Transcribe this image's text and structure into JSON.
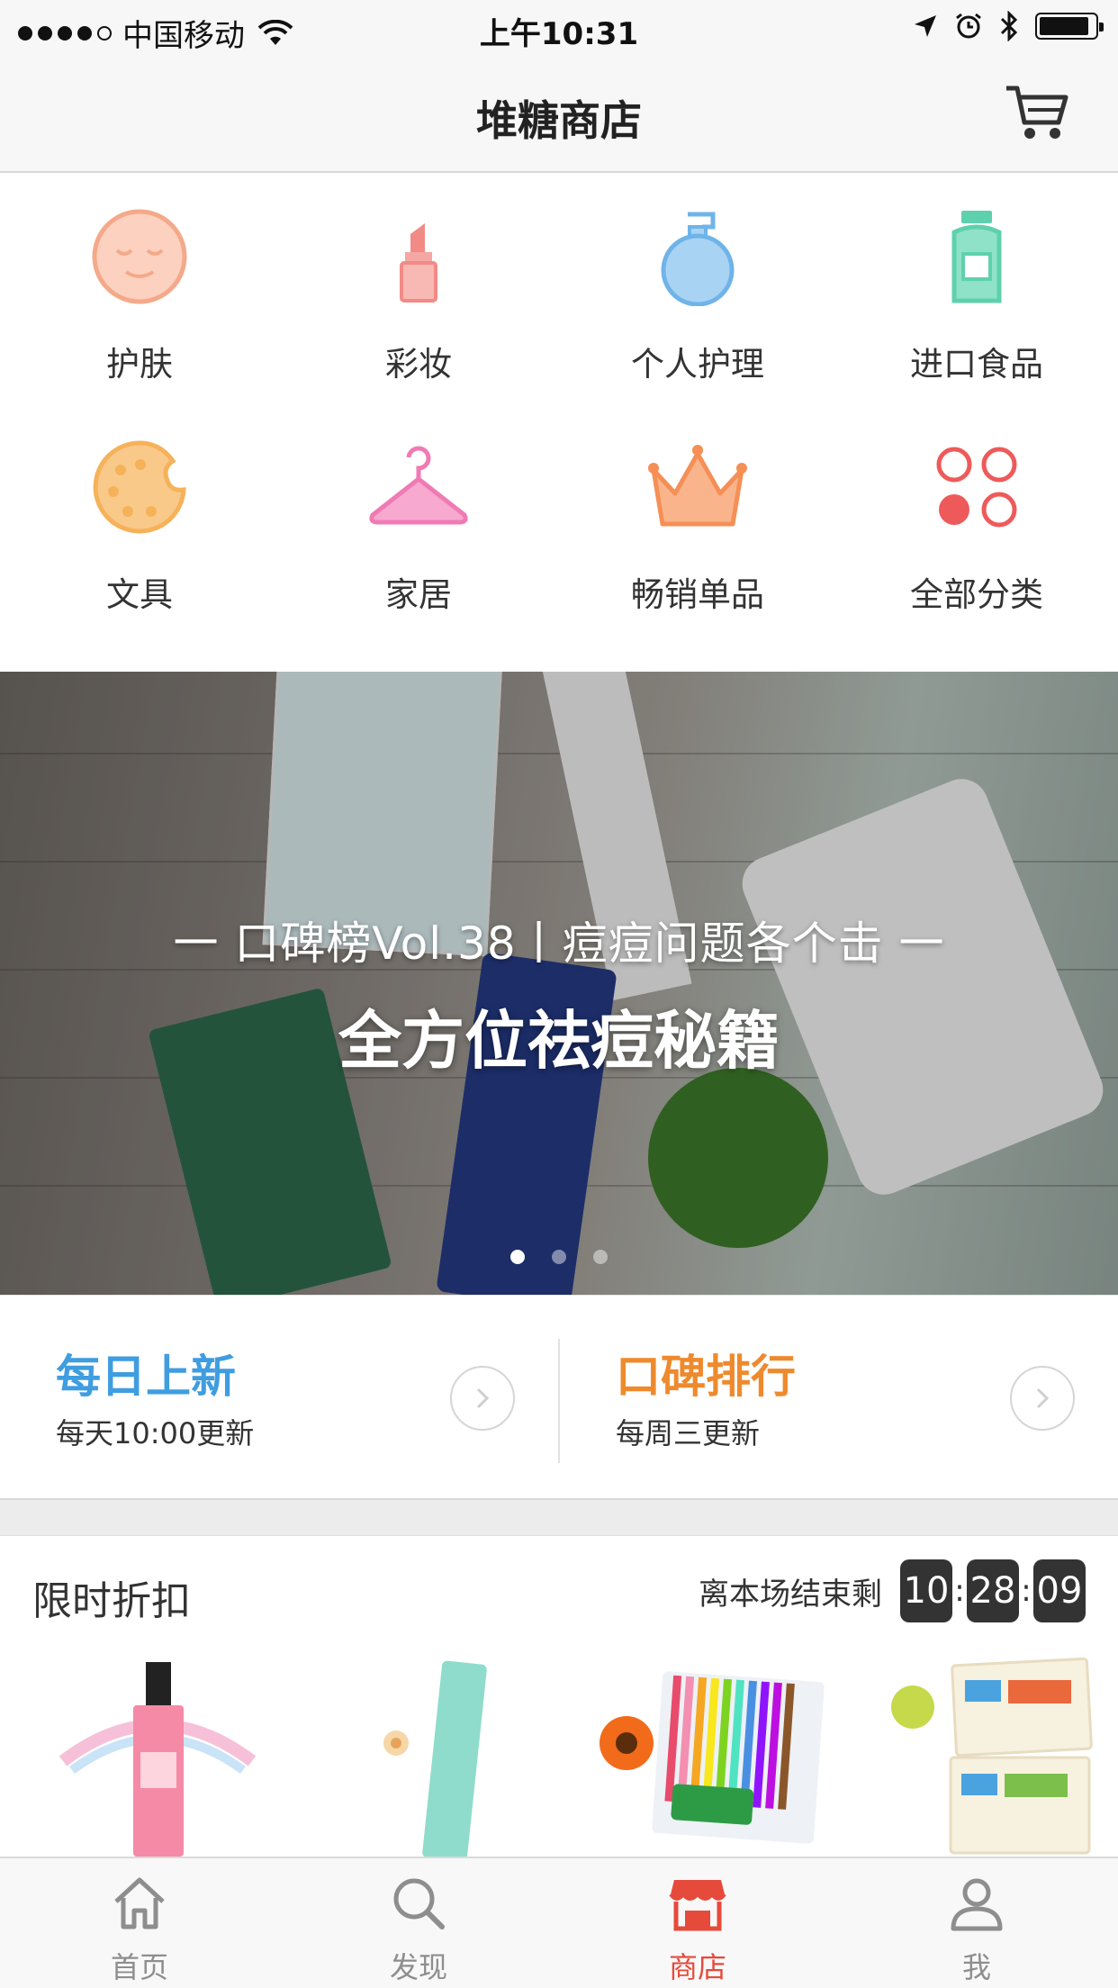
{
  "status_bar": {
    "carrier": "中国移动",
    "time": "上午10:31",
    "battery_level": 0.9,
    "icons": [
      "signal-icon",
      "wifi-icon",
      "location-arrow-icon",
      "alarm-icon",
      "bluetooth-icon",
      "battery-icon"
    ]
  },
  "nav": {
    "title": "堆糖商店",
    "cart_icon": "cart-icon"
  },
  "categories": [
    {
      "label": "护肤",
      "icon": "face-icon",
      "color": "#f4a98a"
    },
    {
      "label": "彩妆",
      "icon": "lipstick-icon",
      "color": "#f28a86"
    },
    {
      "label": "个人护理",
      "icon": "perfume-bottle-icon",
      "color": "#6fb4e8"
    },
    {
      "label": "进口食品",
      "icon": "food-jar-icon",
      "color": "#5fd0ad"
    },
    {
      "label": "文具",
      "icon": "palette-icon",
      "color": "#f6b259"
    },
    {
      "label": "家居",
      "icon": "hanger-icon",
      "color": "#f07bb4"
    },
    {
      "label": "畅销单品",
      "icon": "crown-icon",
      "color": "#f58f56"
    },
    {
      "label": "全部分类",
      "icon": "grid-circles-icon",
      "color": "#ee5a5a"
    }
  ],
  "banner": {
    "subtitle": "一 口碑榜Vol.38丨痘痘问题各个击 一",
    "title": "全方位祛痘秘籍",
    "page_count": 3,
    "active_page": 1
  },
  "features": [
    {
      "title": "每日上新",
      "subtitle": "每天10:00更新",
      "color": "#3f9de0"
    },
    {
      "title": "口碑排行",
      "subtitle": "每周三更新",
      "color": "#ee8a2d"
    }
  ],
  "flash_sale": {
    "title": "限时折扣",
    "countdown_label": "离本场结束剩",
    "hours": "10",
    "minutes": "28",
    "seconds": "09",
    "separator": ":"
  },
  "tabs": [
    {
      "label": "首页",
      "icon": "home-icon",
      "active": false
    },
    {
      "label": "发现",
      "icon": "search-icon",
      "active": false
    },
    {
      "label": "商店",
      "icon": "store-icon",
      "active": true
    },
    {
      "label": "我",
      "icon": "user-icon",
      "active": false
    }
  ],
  "colors": {
    "accent": "#e64a3b",
    "tab_inactive": "#8e8e8e",
    "blue": "#3f9de0",
    "orange": "#ee8a2d"
  }
}
